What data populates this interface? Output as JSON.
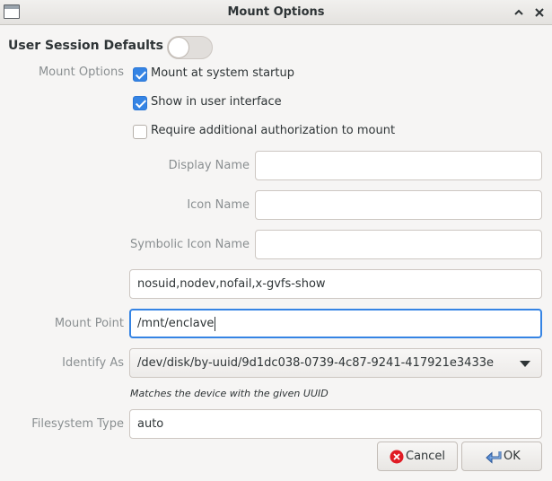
{
  "window": {
    "title": "Mount Options",
    "collapse_icon": "chevron-up-icon",
    "close_icon": "close-icon"
  },
  "session": {
    "label": "User Session Defaults",
    "toggle_on": false
  },
  "mount_options": {
    "label": "Mount Options",
    "checkboxes": [
      {
        "label": "Mount at system startup",
        "checked": true
      },
      {
        "label": "Show in user interface",
        "checked": true
      },
      {
        "label": "Require additional authorization to mount",
        "checked": false
      }
    ]
  },
  "fields": {
    "display_name": {
      "label": "Display Name",
      "value": ""
    },
    "icon_name": {
      "label": "Icon Name",
      "value": ""
    },
    "symbolic_icon_name": {
      "label": "Symbolic Icon Name",
      "value": ""
    },
    "options_value": "nosuid,nodev,nofail,x-gvfs-show",
    "mount_point": {
      "label": "Mount Point",
      "value": "/mnt/enclave"
    },
    "identify_as": {
      "label": "Identify As",
      "value": "/dev/disk/by-uuid/9d1dc038-0739-4c87-9241-417921e3433e"
    },
    "identify_hint": "Matches the device with the given UUID",
    "filesystem_type": {
      "label": "Filesystem Type",
      "value": "auto"
    }
  },
  "buttons": {
    "cancel": "Cancel",
    "ok": "OK"
  },
  "colors": {
    "accent": "#3584e4",
    "cancel_icon": "#e01b24"
  }
}
